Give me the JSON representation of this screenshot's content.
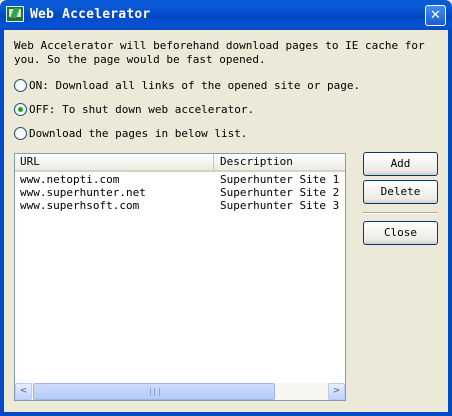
{
  "window": {
    "title": "Web Accelerator",
    "close_glyph": "✕"
  },
  "description": "Web Accelerator will beforehand download pages to IE cache for you. So the page would be fast opened.",
  "options": [
    {
      "label": "ON: Download all links of the opened site or page.",
      "checked": false
    },
    {
      "label": "OFF: To shut down web accelerator.",
      "checked": true
    },
    {
      "label": "Download the pages in below list.",
      "checked": false
    }
  ],
  "list": {
    "columns": [
      "URL",
      "Description"
    ],
    "rows": [
      {
        "url": "www.netopti.com",
        "description": "Superhunter Site 1"
      },
      {
        "url": "www.superhunter.net",
        "description": "Superhunter Site 2"
      },
      {
        "url": "www.superhsoft.com",
        "description": "Superhunter Site 3"
      }
    ],
    "scroll_left_glyph": "<",
    "scroll_right_glyph": ">"
  },
  "buttons": {
    "add": "Add",
    "delete": "Delete",
    "close": "Close"
  },
  "colors": {
    "titlebar": "#0348C4",
    "dialog_bg": "#ECE9D8",
    "radio_dot": "#21A121"
  }
}
